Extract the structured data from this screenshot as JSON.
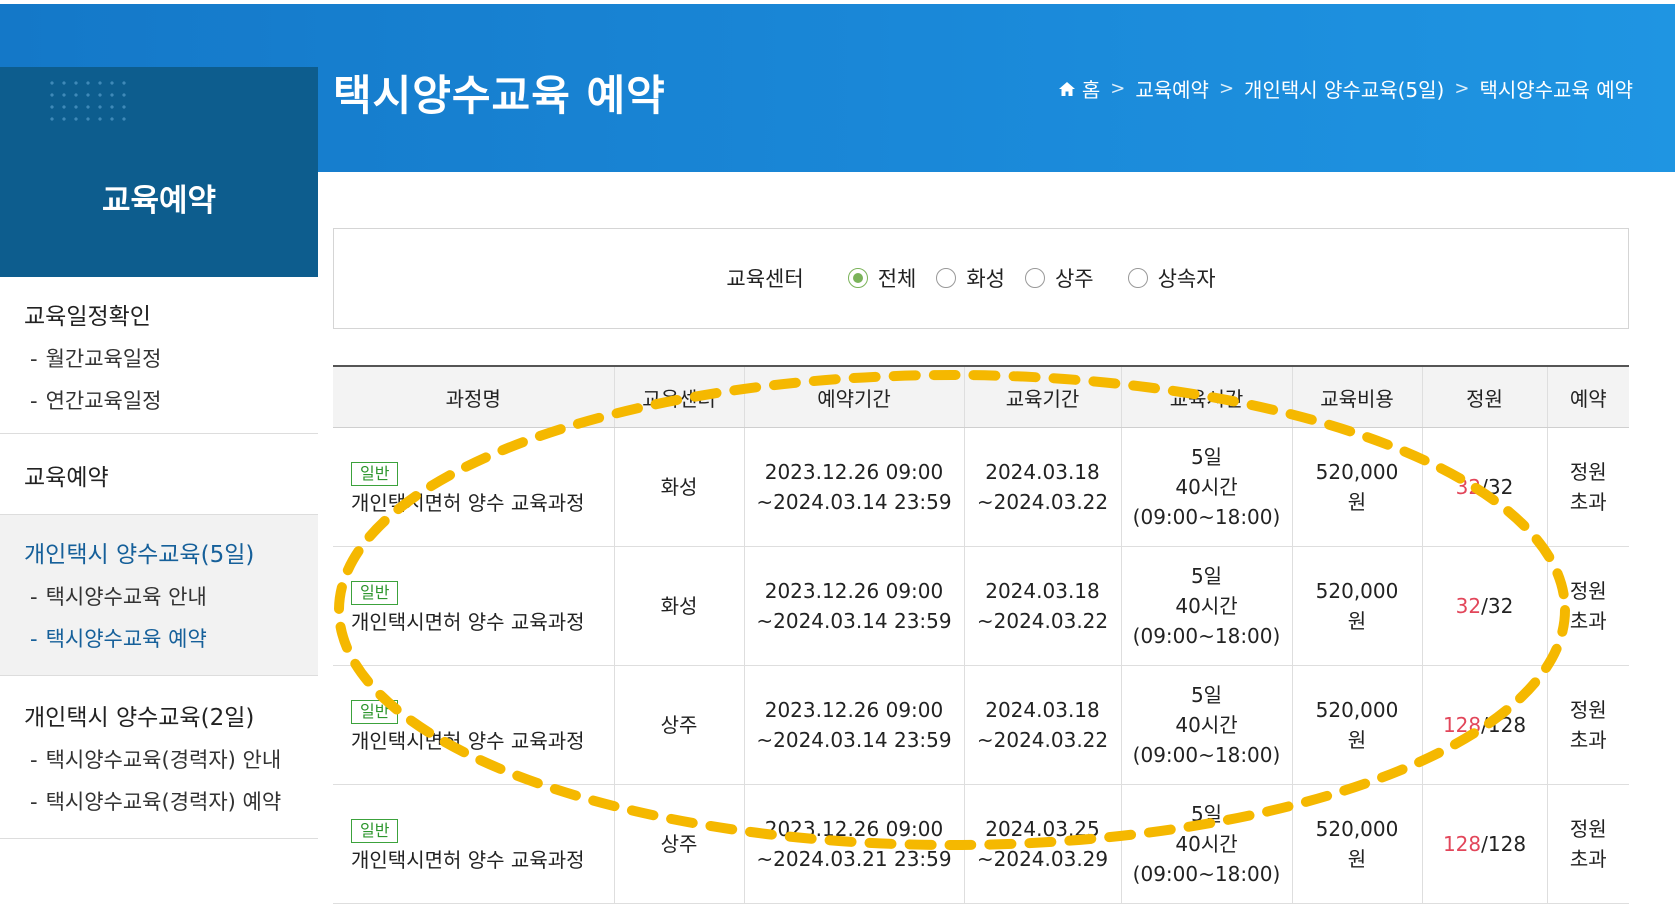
{
  "header": {
    "page_title": "택시양수교육 예약",
    "breadcrumb": {
      "home": "홈",
      "items": [
        "교육예약",
        "개인택시 양수교육(5일)",
        "택시양수교육 예약"
      ],
      "separator": ">"
    }
  },
  "sidebar": {
    "title": "교육예약",
    "groups": [
      {
        "title": "교육일정확인",
        "items": [
          {
            "label": "월간교육일정"
          },
          {
            "label": "연간교육일정"
          }
        ]
      },
      {
        "title": "교육예약",
        "items": []
      },
      {
        "title": "개인택시 양수교육(5일)",
        "items": [
          {
            "label": "택시양수교육 안내"
          },
          {
            "label": "택시양수교육 예약"
          }
        ]
      },
      {
        "title": "개인택시 양수교육(2일)",
        "items": [
          {
            "label": "택시양수교육(경력자) 안내"
          },
          {
            "label": "택시양수교육(경력자) 예약"
          }
        ]
      }
    ],
    "dash": "-"
  },
  "filter": {
    "label": "교육센터",
    "options": [
      "전체",
      "화성",
      "상주",
      "상속자"
    ],
    "selected": "전체"
  },
  "table": {
    "headers": [
      "과정명",
      "교육센터",
      "예약기간",
      "교육기간",
      "교육시간",
      "교육비용",
      "정원",
      "예약"
    ],
    "rows": [
      {
        "badge": "일반",
        "name": "개인택시면허 양수 교육과정",
        "center": "화성",
        "reserve_start": "2023.12.26 09:00",
        "reserve_end": "~2024.03.14 23:59",
        "edu_start": "2024.03.18",
        "edu_end": "~2024.03.22",
        "days": "5일",
        "hours": "40시간",
        "time": "(09:00~18:00)",
        "cost": "520,000",
        "unit": "원",
        "cap_used": "32",
        "cap_total": "/32",
        "status_1": "정원",
        "status_2": "초과"
      },
      {
        "badge": "일반",
        "name": "개인택시면허 양수 교육과정",
        "center": "화성",
        "reserve_start": "2023.12.26 09:00",
        "reserve_end": "~2024.03.14 23:59",
        "edu_start": "2024.03.18",
        "edu_end": "~2024.03.22",
        "days": "5일",
        "hours": "40시간",
        "time": "(09:00~18:00)",
        "cost": "520,000",
        "unit": "원",
        "cap_used": "32",
        "cap_total": "/32",
        "status_1": "정원",
        "status_2": "초과"
      },
      {
        "badge": "일반",
        "name": "개인택시면허 양수 교육과정",
        "center": "상주",
        "reserve_start": "2023.12.26 09:00",
        "reserve_end": "~2024.03.14 23:59",
        "edu_start": "2024.03.18",
        "edu_end": "~2024.03.22",
        "days": "5일",
        "hours": "40시간",
        "time": "(09:00~18:00)",
        "cost": "520,000",
        "unit": "원",
        "cap_used": "128",
        "cap_total": "/128",
        "status_1": "정원",
        "status_2": "초과"
      },
      {
        "badge": "일반",
        "name": "개인택시면허 양수 교육과정",
        "center": "상주",
        "reserve_start": "2023.12.26 09:00",
        "reserve_end": "~2024.03.21 23:59",
        "edu_start": "2024.03.25",
        "edu_end": "~2024.03.29",
        "days": "5일",
        "hours": "40시간",
        "time": "(09:00~18:00)",
        "cost": "520,000",
        "unit": "원",
        "cap_used": "128",
        "cap_total": "/128",
        "status_1": "정원",
        "status_2": "초과"
      }
    ]
  },
  "colors": {
    "banner": "#1a88d8",
    "sidebar_head": "#0d5d8e",
    "active_link": "#16609a",
    "badge_green": "#2d962d",
    "capacity_red": "#e2465a",
    "annotation": "#f5b800"
  },
  "icons": {
    "home": "home-icon",
    "annotation": "dashed-ellipse-annotation"
  }
}
